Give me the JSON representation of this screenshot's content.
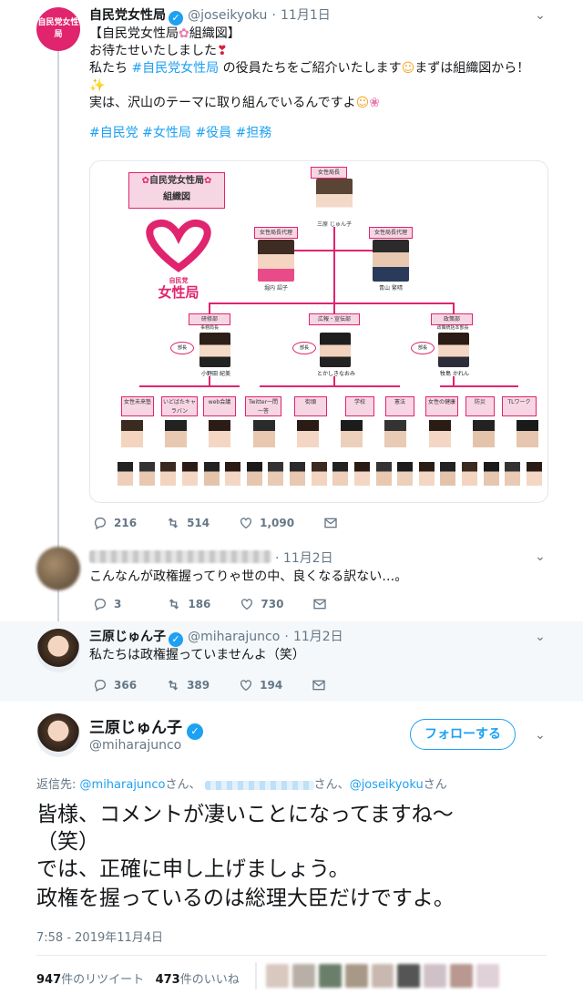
{
  "tweet1": {
    "name": "自民党女性局",
    "handle": "@joseikyoku",
    "date": "11月1日",
    "avatar_text": "自民党女性局",
    "line1": "【自民党女性局",
    "line1_end": "組織図】",
    "line2": "お待たせいたしました",
    "line3_a": "私たち",
    "line3_link": "#自民党女性局",
    "line3_b": "の役員たちをご紹介いたします",
    "line3_c": "まずは組織図から！",
    "line4": "実は、沢山のテーマに取り組んでいるんですよ",
    "hashtags": "#自民党 #女性局 #役員 #担務",
    "replies": "216",
    "retweets": "514",
    "likes": "1,090"
  },
  "chart": {
    "title_line1": "自民党女性局",
    "title_line2": "組織図",
    "logo_small": "自民党",
    "logo_big": "女性局",
    "chief_label": "女性局長",
    "chief_name": "三原 じゅん子",
    "deputy_label": "女性局長代理",
    "deputy_name": "堀内 詔子",
    "deputy2_label": "女性局長代理",
    "deputy2_name": "青山 繁晴",
    "dept1": "研修部",
    "dept1_sub": "事務局長",
    "dept1_name": "小野田 紀美",
    "dept2": "広報・宣伝部",
    "dept2_name": "とかしきなおみ",
    "dept3": "政策部",
    "dept3_sub": "政策統括本部長",
    "dept3_name": "牧島 かれん",
    "bucho": "部長",
    "teams": [
      "女性未来塾",
      "いどばたキャラバン",
      "web会議",
      "Twitter一問一答",
      "街頭",
      "学校",
      "憲法",
      "女性の健康",
      "防災",
      "TLワーク"
    ]
  },
  "tweet2": {
    "date": "11月2日",
    "text": "こんなんが政権握ってりゃ世の中、良くなる訳ない…。",
    "replies": "3",
    "retweets": "186",
    "likes": "730"
  },
  "tweet3": {
    "name": "三原じゅん子",
    "handle": "@miharajunco",
    "date": "11月2日",
    "text": "私たちは政権握っていませんよ（笑）",
    "replies": "366",
    "retweets": "389",
    "likes": "194"
  },
  "main": {
    "name": "三原じゅん子",
    "handle": "@miharajunco",
    "follow": "フォローする",
    "reply_to_label": "返信先:",
    "reply_to_1": "@miharajunco",
    "reply_san": "さん、",
    "reply_to_3": "@joseikyoku",
    "reply_san_end": "さん",
    "text_line1": "皆様、コメントが凄いことになってますね〜",
    "text_line2": "（笑）",
    "text_line3": "では、正確に申し上げましょう。",
    "text_line4": "政権を握っているのは総理大臣だけですよ。",
    "timestamp": "7:58 - 2019年11月4日",
    "retweet_count": "947",
    "retweet_label": "件のリツイート",
    "like_count": "473",
    "like_label": "件のいいね"
  },
  "colors": {
    "accent": "#1da1f2",
    "brand_pink": "#e0246e",
    "muted": "#657786"
  }
}
